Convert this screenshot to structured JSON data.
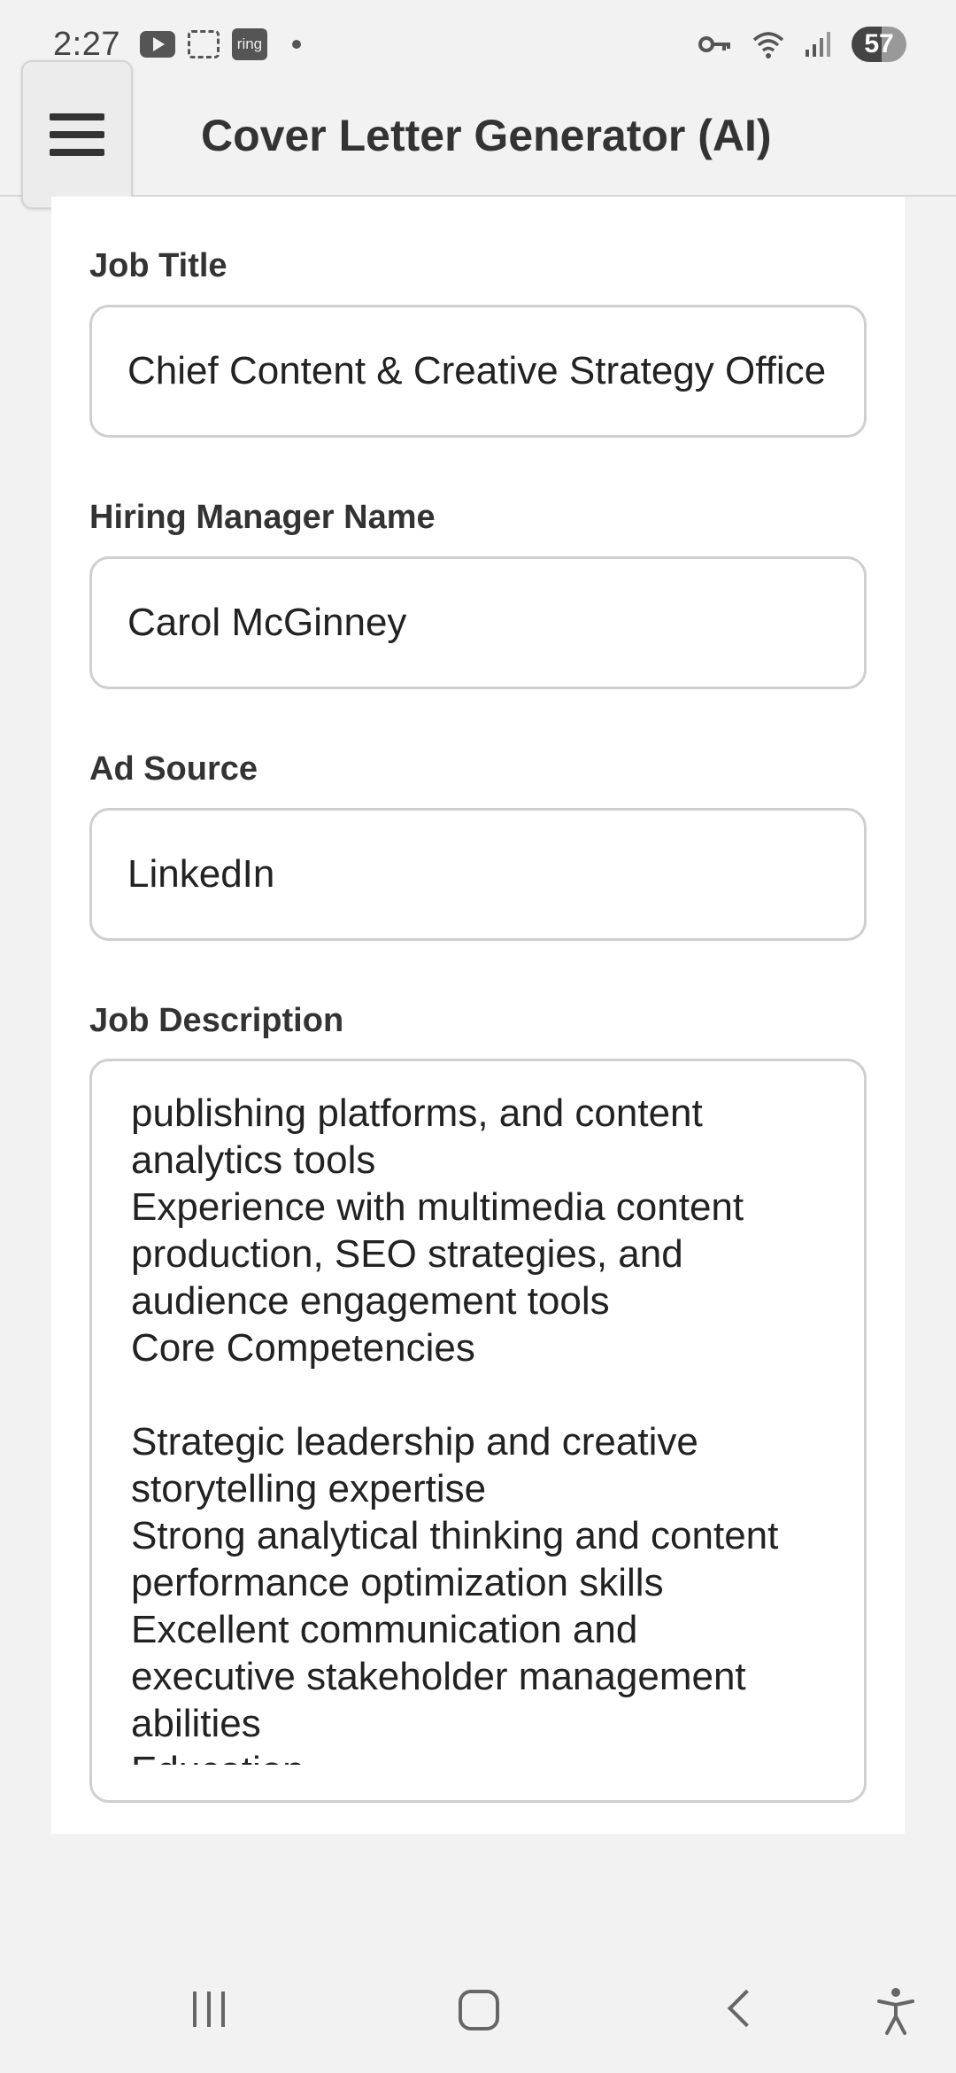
{
  "status_bar": {
    "time": "2:27",
    "icons": [
      "youtube-icon",
      "screenshot-icon",
      "ring-icon",
      "dot-icon",
      "vpn-key-icon",
      "wifi-icon",
      "signal-icon"
    ],
    "ring_label": "ring",
    "battery": "57"
  },
  "header": {
    "title": "Cover Letter Generator (AI)"
  },
  "form": {
    "job_title": {
      "label": "Job Title",
      "value": "Chief Content & Creative Strategy Officer"
    },
    "hiring_manager": {
      "label": "Hiring Manager Name",
      "value": "Carol McGinney"
    },
    "ad_source": {
      "label": "Ad Source",
      "value": "LinkedIn"
    },
    "job_description": {
      "label": "Job Description",
      "lines": [
        "publishing platforms, and content",
        "analytics tools",
        "Experience with multimedia content",
        "production, SEO strategies, and",
        "audience engagement tools",
        "Core Competencies",
        "",
        "Strategic leadership and creative",
        "storytelling expertise",
        "Strong analytical thinking and content",
        "performance optimization skills",
        "Excellent communication and",
        "executive stakeholder management",
        "abilities",
        "Education"
      ]
    }
  },
  "colors": {
    "background": "#f2f2f2",
    "card": "#ffffff",
    "border": "#cfcfcf",
    "text": "#222222"
  }
}
